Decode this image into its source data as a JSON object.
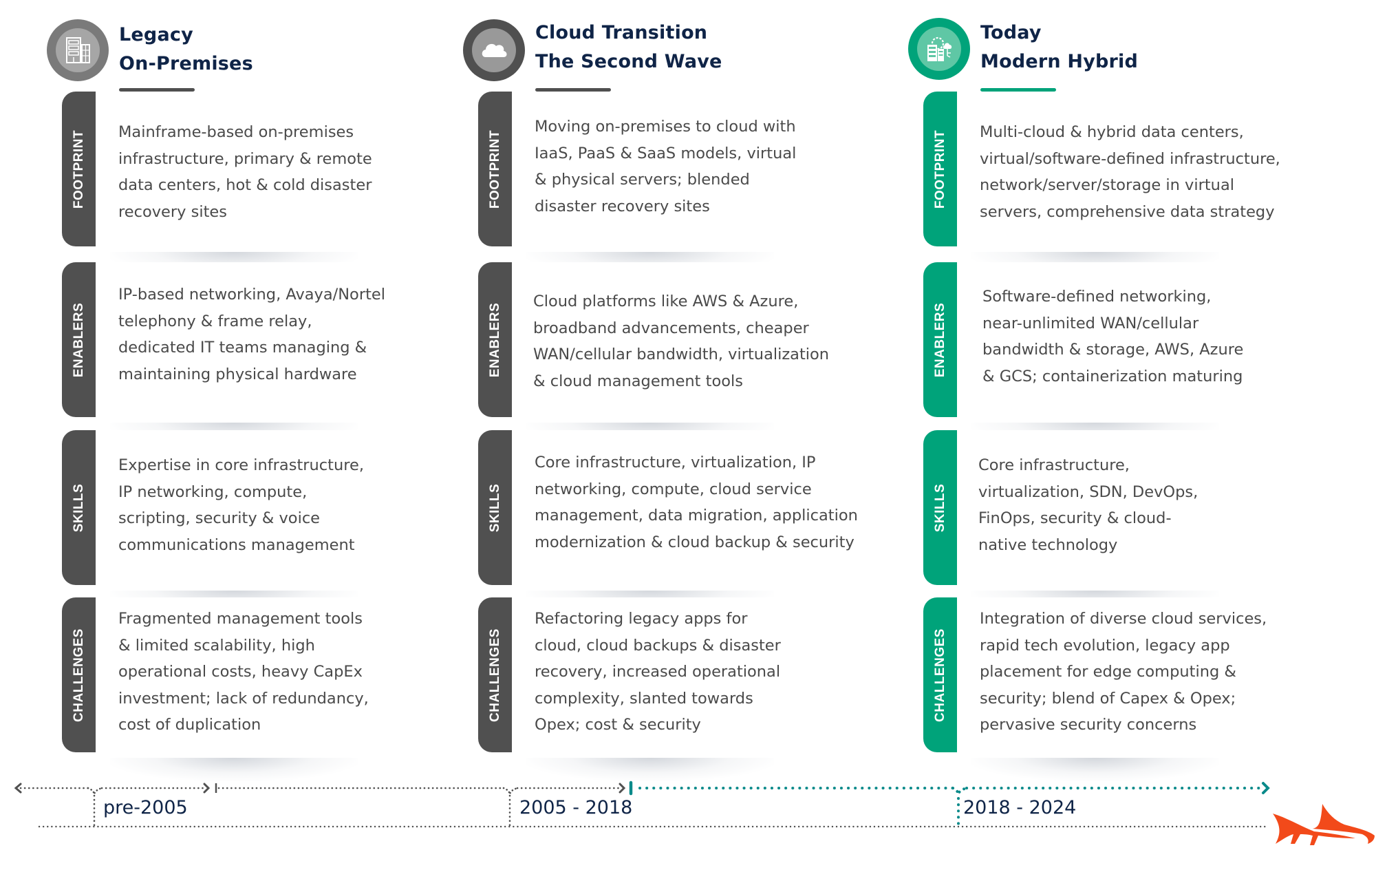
{
  "colors": {
    "navy_title": "#0f2447",
    "gray_dark": "#505050",
    "gray_mid": "#7a7a7a",
    "gray_light": "#a6a6a6",
    "teal": "#00a37a",
    "teal_light": "#5fc7a5",
    "timeline_teal": "#0a8a8a",
    "logo_orange": "#f24a1a",
    "body_text": "#4a4a4a"
  },
  "eras": [
    {
      "title_line1": "Legacy",
      "title_line2": "On-Premises",
      "icon": "building-icon",
      "rows": [
        {
          "label": "FOOTPRINT",
          "text": "Mainframe-based on-premises\ninfrastructure, primary & remote\ndata centers, hot & cold disaster\nrecovery sites"
        },
        {
          "label": "ENABLERS",
          "text": "IP-based networking, Avaya/Nortel\ntelephony & frame relay,\ndedicated IT teams managing &\nmaintaining physical hardware"
        },
        {
          "label": "SKILLS",
          "text": "Expertise in core infrastructure,\nIP networking, compute,\nscripting, security & voice\ncommunications management"
        },
        {
          "label": "CHALLENGES",
          "text": "Fragmented management tools\n& limited scalability, high\noperational costs, heavy CapEx\ninvestment; lack of redundancy,\ncost of duplication"
        }
      ]
    },
    {
      "title_line1": "Cloud Transition",
      "title_line2": "The Second Wave",
      "icon": "cloud-icon",
      "rows": [
        {
          "label": "FOOTPRINT",
          "text": "Moving on-premises to cloud with\nIaaS, PaaS & SaaS models, virtual\n& physical servers; blended\ndisaster recovery sites"
        },
        {
          "label": "ENABLERS",
          "text": "Cloud platforms like AWS & Azure,\nbroadband advancements, cheaper\nWAN/cellular bandwidth, virtualization\n& cloud management tools"
        },
        {
          "label": "SKILLS",
          "text": "Core infrastructure, virtualization, IP\nnetworking, compute, cloud service\nmanagement, data migration, application\nmodernization & cloud backup & security"
        },
        {
          "label": "CHALLENGES",
          "text": "Refactoring legacy apps for\ncloud, cloud backups & disaster\nrecovery, increased operational\ncomplexity, slanted towards\nOpex; cost & security"
        }
      ]
    },
    {
      "title_line1": "Today",
      "title_line2": "Modern Hybrid",
      "icon": "hybrid-datacenter-icon",
      "rows": [
        {
          "label": "FOOTPRINT",
          "text": "Multi-cloud & hybrid data centers,\nvirtual/software-defined infrastructure,\nnetwork/server/storage in virtual\nservers, comprehensive data strategy"
        },
        {
          "label": "ENABLERS",
          "text": "Software-defined networking,\nnear-unlimited WAN/cellular\nbandwidth & storage, AWS, Azure\n& GCS; containerization maturing"
        },
        {
          "label": "SKILLS",
          "text": "Core infrastructure,\nvirtualization, SDN, DevOps,\nFinOps, security & cloud-\nnative technology"
        },
        {
          "label": "CHALLENGES",
          "text": "Integration of diverse cloud services,\nrapid tech evolution, legacy app\nplacement for edge computing &\nsecurity;  blend of Capex & Opex;\npervasive security concerns"
        }
      ]
    }
  ],
  "timeline": {
    "periods": [
      "pre-2005",
      "2005 - 2018",
      "2018 - 2024"
    ]
  },
  "logo": {
    "icon": "shark-logo-icon"
  }
}
